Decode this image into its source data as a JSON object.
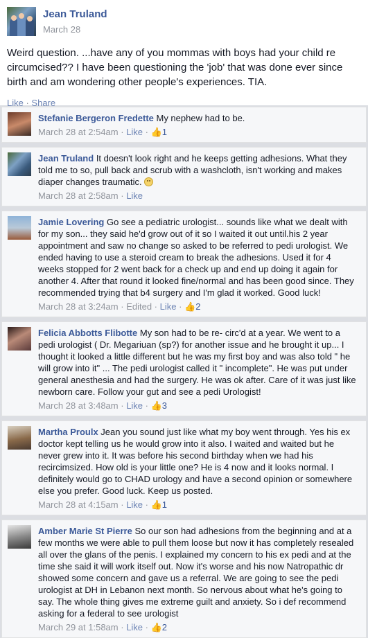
{
  "post": {
    "author": "Jean Truland",
    "date": "March 28",
    "text": "Weird question. ...have any of you mommas with boys had your child re circumcised?? I have been questioning the 'job' that was done ever since birth and am wondering other people's experiences. TIA.",
    "like_label": "Like",
    "separator": " · ",
    "share_label": "Share"
  },
  "comments": [
    {
      "name": "Stefanie Bergeron Fredette",
      "text": " My nephew had to be.",
      "timestamp": "March 28 at 2:54am",
      "edited": "",
      "like_label": "Like",
      "like_count": "1",
      "avatar": "profile-photo"
    },
    {
      "name": "Jean Truland",
      "text": " It doesn't look right and he keeps getting adhesions. What they told me to so, pull back and scrub with a washcloth, isn't working and makes diaper changes traumatic. ",
      "timestamp": "March 28 at 2:58am",
      "edited": "",
      "like_label": "Like",
      "like_count": "",
      "avatar": "profile-photo"
    },
    {
      "name": "Jamie Lovering",
      "text": " Go see a pediatric urologist... sounds like what we dealt with for my son... they said he'd grow out of it so I waited it out until.his 2 year appointment and saw no change so asked to be referred to pedi urologist. We ended having to use a steroid cream to break the adhesions. Used it for 4 weeks stopped for 2 went back for a check up and end up doing it again for another 4. After that round it looked fine/normal and has been good since. They recommended trying that b4 surgery and I'm glad it worked. Good luck!",
      "timestamp": "March 28 at 3:24am",
      "edited": "Edited",
      "like_label": "Like",
      "like_count": "2",
      "avatar": "profile-photo"
    },
    {
      "name": "Felicia Abbotts Flibotte",
      "text": " My son had to be re- circ'd at a year. We went to a pedi urologist ( Dr. Megariuan (sp?) for another issue and he brought it up... I thought it looked a little different but he was my first boy and was also told \" he will grow into it\" ... The pedi urologist called it \" incomplete\". He was put under general anesthesia and had the surgery. He was ok after. Care of it was just like newborn care. Follow your gut and see a pedi Urologist!",
      "timestamp": "March 28 at 3:48am",
      "edited": "",
      "like_label": "Like",
      "like_count": "3",
      "avatar": "profile-photo"
    },
    {
      "name": "Martha Proulx",
      "text": " Jean you sound just like what my boy went through. Yes his ex doctor kept telling us he would grow into it also. I waited and waited but he never grew into it. It was before his second birthday when we had his recircimsized. How old is your little one? He is 4 now and it looks normal. I definitely would go to CHAD urology and have a second opinion or somewhere else you prefer. Good luck. Keep us posted.",
      "timestamp": "March 28 at 4:15am",
      "edited": "",
      "like_label": "Like",
      "like_count": "1",
      "avatar": "profile-photo"
    },
    {
      "name": "Amber Marie St Pierre",
      "text": " So our son had adhesions from the beginning and at a few months we were able to pull them loose but now it has completely resealed all over the glans of the penis. I explained my concern to his ex pedi and at the time she said it will work itself out. Now it's worse and his now Natropathic dr showed some concern and gave us a referral. We are going to see the pedi urologist at DH in Lebanon next month. So nervous about what he's going to say. The whole thing gives me extreme guilt and anxiety. So i def recommend asking for a federal to see urologist",
      "timestamp": "March 29 at 1:58am",
      "edited": "",
      "like_label": "Like",
      "like_count": "2",
      "avatar": "profile-photo"
    }
  ],
  "icons": {
    "like_count_icon": "thumbs-up-icon",
    "frown": "frown-emoji-icon"
  },
  "colors": {
    "name_link": "#3b5998",
    "meta_gray": "#90949c",
    "comment_bg": "#f6f7f9",
    "divider": "#dcdee3"
  }
}
